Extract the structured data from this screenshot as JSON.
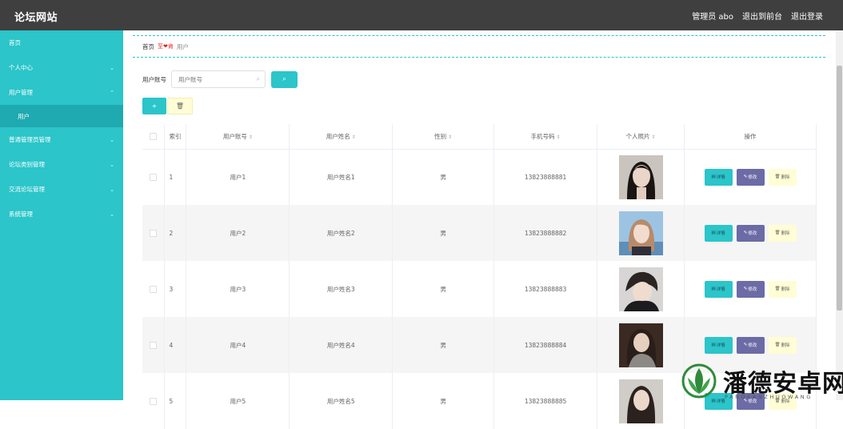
{
  "header": {
    "title": "论坛网站",
    "admin_label": "管理员 abo",
    "back_label": "退出到前台",
    "logout_label": "退出登录"
  },
  "sidebar": {
    "items": [
      {
        "label": "首页"
      },
      {
        "label": "个人中心"
      },
      {
        "label": "用户管理"
      },
      {
        "label": "用户"
      },
      {
        "label": "普通管理员管理"
      },
      {
        "label": "论坛类别管理"
      },
      {
        "label": "交流论坛管理"
      },
      {
        "label": "系统管理"
      }
    ]
  },
  "breadcrumb": {
    "home": "首页",
    "separator": "至❤肯",
    "current": "用户"
  },
  "search": {
    "label": "用户账号",
    "placeholder": "用户账号"
  },
  "table": {
    "headers": [
      "索引",
      "用户账号",
      "用户姓名",
      "性别",
      "手机号码",
      "个人照片",
      "操作"
    ],
    "rows": [
      {
        "index": "1",
        "account": "用户1",
        "name": "用户姓名1",
        "gender": "男",
        "phone": "13823888881"
      },
      {
        "index": "2",
        "account": "用户2",
        "name": "用户姓名2",
        "gender": "男",
        "phone": "13823888882"
      },
      {
        "index": "3",
        "account": "用户3",
        "name": "用户姓名3",
        "gender": "男",
        "phone": "13823888883"
      },
      {
        "index": "4",
        "account": "用户4",
        "name": "用户姓名4",
        "gender": "男",
        "phone": "13823888884"
      },
      {
        "index": "5",
        "account": "用户5",
        "name": "用户姓名5",
        "gender": "男",
        "phone": "13823888885"
      }
    ],
    "op_detail": "详情",
    "op_edit": "修改",
    "op_delete": "删除"
  },
  "watermark": {
    "text": "潘德安卓网",
    "sub": "PANDEANZHUOWANG"
  },
  "colors": {
    "topbar": "#3f3f3f",
    "accent": "#2bc5ca",
    "edit": "#6c6ba5",
    "delete": "#fffdd5"
  }
}
